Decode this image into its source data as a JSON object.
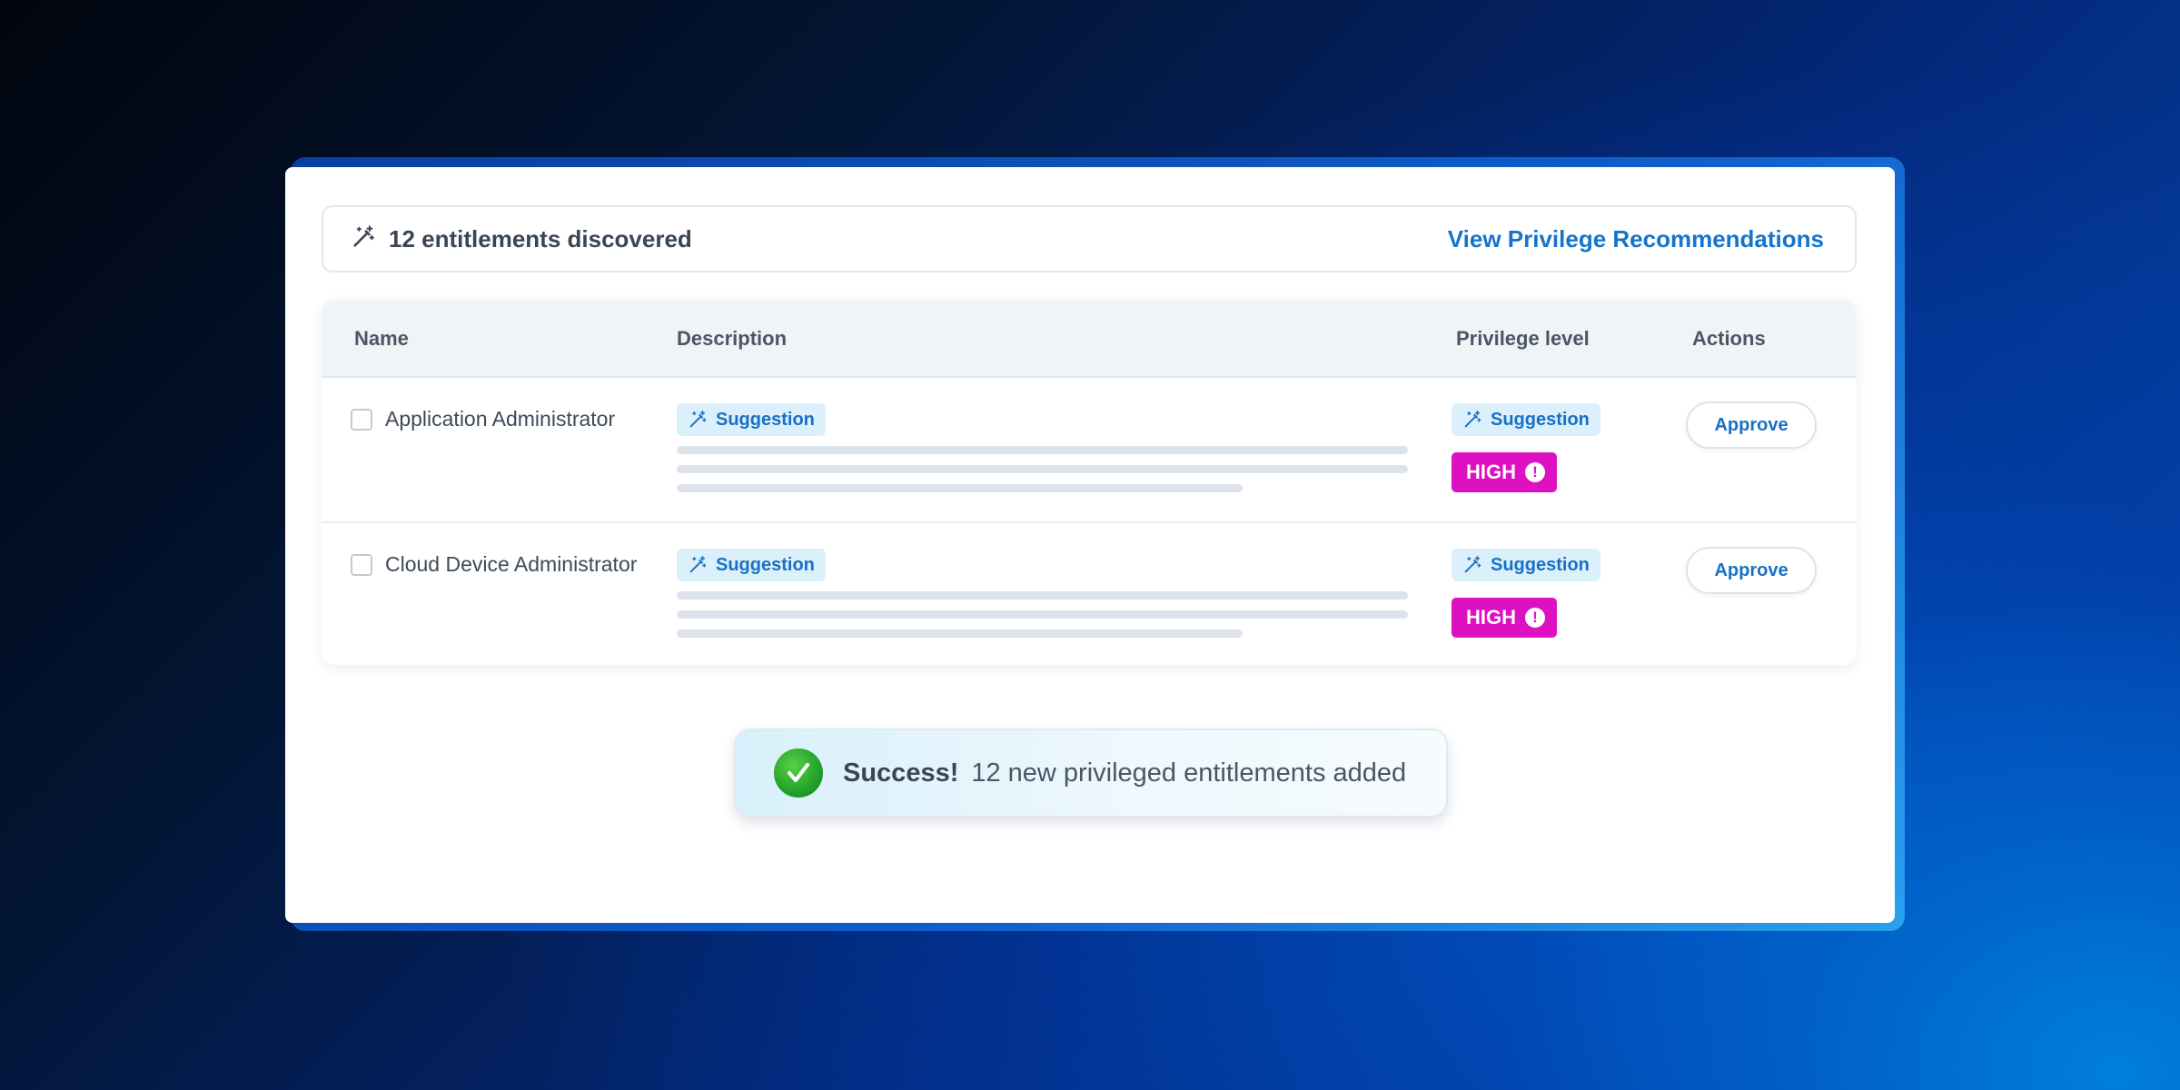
{
  "colors": {
    "accent": "#1574cc",
    "high_badge": "#dd10c2",
    "success": "#26a62c",
    "suggestion_bg": "#dcf0fb"
  },
  "header": {
    "icon": "magic-wand-icon",
    "title": "12 entitlements discovered",
    "link": "View Privilege Recommendations"
  },
  "table": {
    "columns": [
      "Name",
      "Description",
      "Privilege level",
      "Actions"
    ],
    "rows": [
      {
        "name": "Application Administrator",
        "description_tag": "Suggestion",
        "privilege_tag": "Suggestion",
        "privilege_level": "HIGH",
        "action": "Approve"
      },
      {
        "name": "Cloud Device Administrator",
        "description_tag": "Suggestion",
        "privilege_tag": "Suggestion",
        "privilege_level": "HIGH",
        "action": "Approve"
      }
    ]
  },
  "toast": {
    "icon": "checkmark-icon",
    "title": "Success!",
    "message": "12 new privileged entitlements added"
  }
}
